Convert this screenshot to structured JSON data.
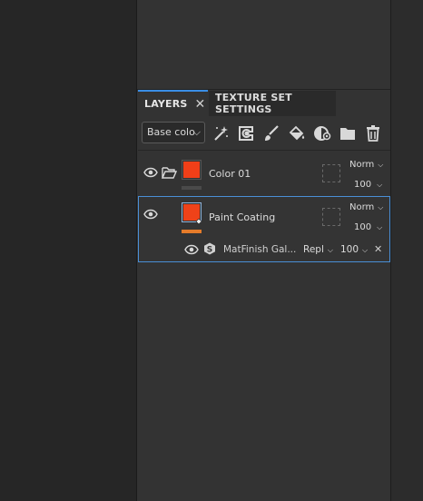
{
  "tabs": {
    "layers": "LAYERS",
    "layers_close": "✕",
    "texture_set_settings": "TEXTURE SET SETTINGS"
  },
  "toolbar": {
    "channel_select": "Base colo",
    "channel_chevron": "⌵",
    "tools": [
      "magic-wand-icon",
      "smart-material-icon",
      "brush-icon",
      "fill-bucket-icon",
      "smart-mask-icon",
      "folder-icon",
      "trash-icon"
    ]
  },
  "layers": [
    {
      "name": "Color 01",
      "thumb_color": "#f13f18",
      "bar_color": "#4a4a4a",
      "blend": "Norm",
      "chevron": "⌵",
      "opacity": "100"
    },
    {
      "name": "Paint Coating",
      "thumb_color": "#ef4219",
      "bar_color": "#e57b2a",
      "blend": "Norm",
      "chevron": "⌵",
      "opacity": "100",
      "effect": {
        "name": "MatFinish Gal...",
        "blend": "Repl",
        "opacity": "100",
        "close": "✕"
      }
    }
  ],
  "colors": {
    "accent": "#3a8ee6",
    "selected_border": "#4a8fd6",
    "panel_bg": "#333333"
  }
}
